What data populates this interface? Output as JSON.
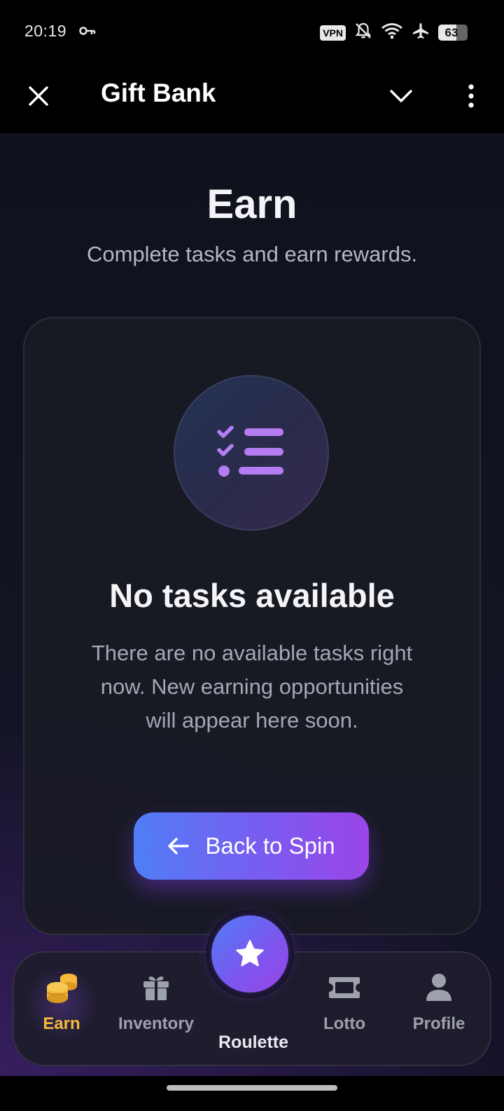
{
  "status_bar": {
    "time": "20:19",
    "vpn_label": "VPN",
    "battery_level": "63",
    "icons": [
      "key-icon",
      "vpn-icon",
      "silent-icon",
      "wifi-icon",
      "airplane-icon",
      "battery-icon"
    ]
  },
  "app_bar": {
    "title": "Gift Bank",
    "icons": [
      "close-icon",
      "chevron-down-icon",
      "more-vert-icon"
    ]
  },
  "page": {
    "title": "Earn",
    "subtitle": "Complete tasks and earn rewards."
  },
  "empty_state": {
    "icon": "task-list-icon",
    "title": "No tasks available",
    "description": "There are no available tasks right now. New earning opportunities will appear here soon.",
    "button_label": "Back to Spin"
  },
  "bottom_nav": {
    "items": [
      {
        "label": "Earn",
        "icon": "coins-icon",
        "active": true
      },
      {
        "label": "Inventory",
        "icon": "gift-icon",
        "active": false
      },
      {
        "label": "Roulette",
        "icon": "star-icon",
        "active": false
      },
      {
        "label": "Lotto",
        "icon": "ticket-icon",
        "active": false
      },
      {
        "label": "Profile",
        "icon": "user-icon",
        "active": false
      }
    ]
  },
  "colors": {
    "accent_gold": "#f4b93a",
    "accent_purple": "#b57cf2",
    "button_gradient_start": "#4f7ef6",
    "button_gradient_end": "#9b45e8",
    "background": "#0f111c"
  }
}
